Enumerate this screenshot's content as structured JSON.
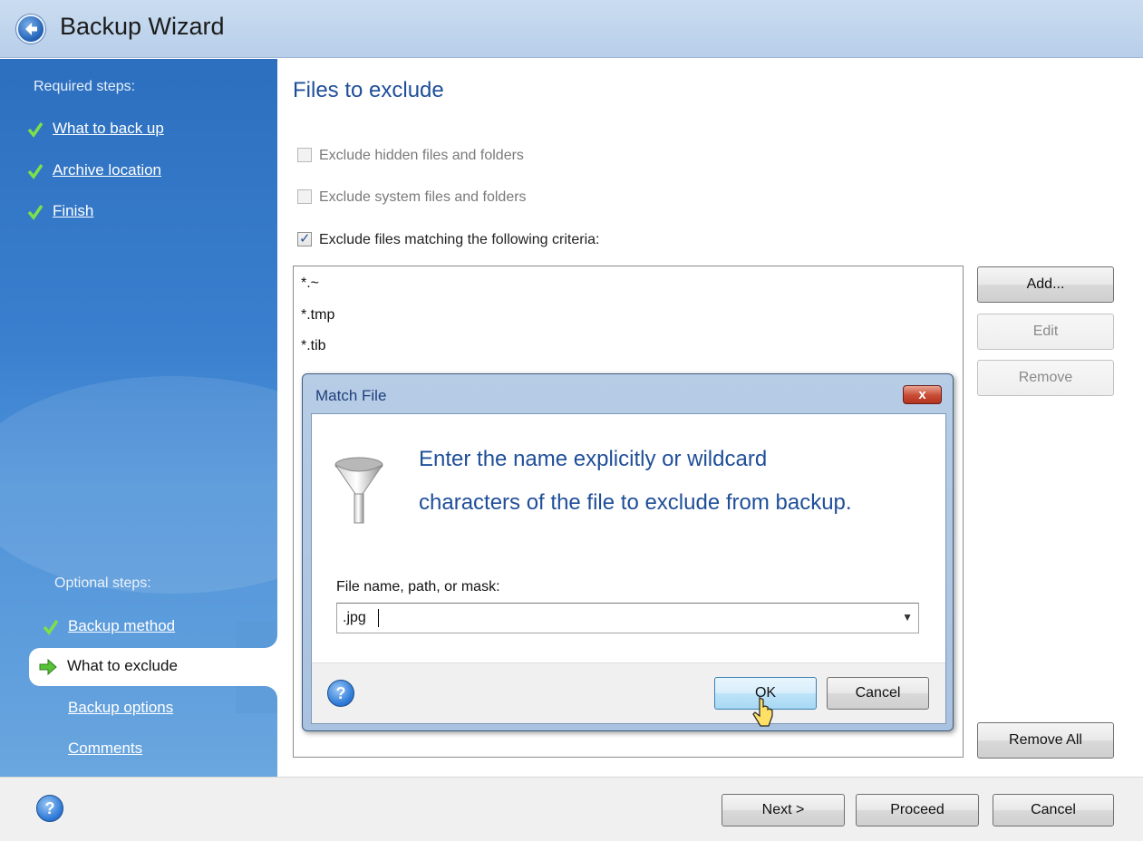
{
  "window": {
    "title": "Backup Wizard"
  },
  "sidebar": {
    "required_heading": "Required steps:",
    "required_items": [
      {
        "label": "What to back up"
      },
      {
        "label": "Archive location"
      },
      {
        "label": "Finish"
      }
    ],
    "optional_heading": "Optional steps:",
    "optional_items": [
      {
        "label": "Backup method"
      },
      {
        "label": "What to exclude"
      },
      {
        "label": "Backup options"
      },
      {
        "label": "Comments"
      }
    ]
  },
  "main": {
    "title": "Files to exclude",
    "checkboxes": [
      {
        "label": "Exclude hidden files and folders",
        "checked": false,
        "enabled": false
      },
      {
        "label": "Exclude system files and folders",
        "checked": false,
        "enabled": false
      },
      {
        "label": "Exclude files matching the following criteria:",
        "checked": true,
        "enabled": true
      }
    ],
    "criteria": [
      "*.~",
      "*.tmp",
      "*.tib"
    ],
    "buttons": {
      "add": "Add...",
      "edit": "Edit",
      "remove": "Remove",
      "remove_all": "Remove All"
    }
  },
  "dialog": {
    "title": "Match File",
    "close": "x",
    "message_line1": "Enter the name explicitly or wildcard",
    "message_line2": "characters of the file to exclude from backup.",
    "field_label": "File name, path, or mask:",
    "field_value": ".jpg",
    "ok": "OK",
    "cancel": "Cancel"
  },
  "footer": {
    "next": "Next >",
    "proceed": "Proceed",
    "cancel": "Cancel"
  },
  "icons": {
    "back": "back-arrow-icon",
    "check": "green-check-icon",
    "current": "green-arrow-icon",
    "help": "help-icon",
    "funnel": "funnel-icon",
    "dropdown": "chevron-down-icon",
    "cursor": "mouse-pointer-icon"
  },
  "colors": {
    "accent": "#1f4e99",
    "sidebar": "#3a80cf",
    "check": "#6fd23a"
  }
}
